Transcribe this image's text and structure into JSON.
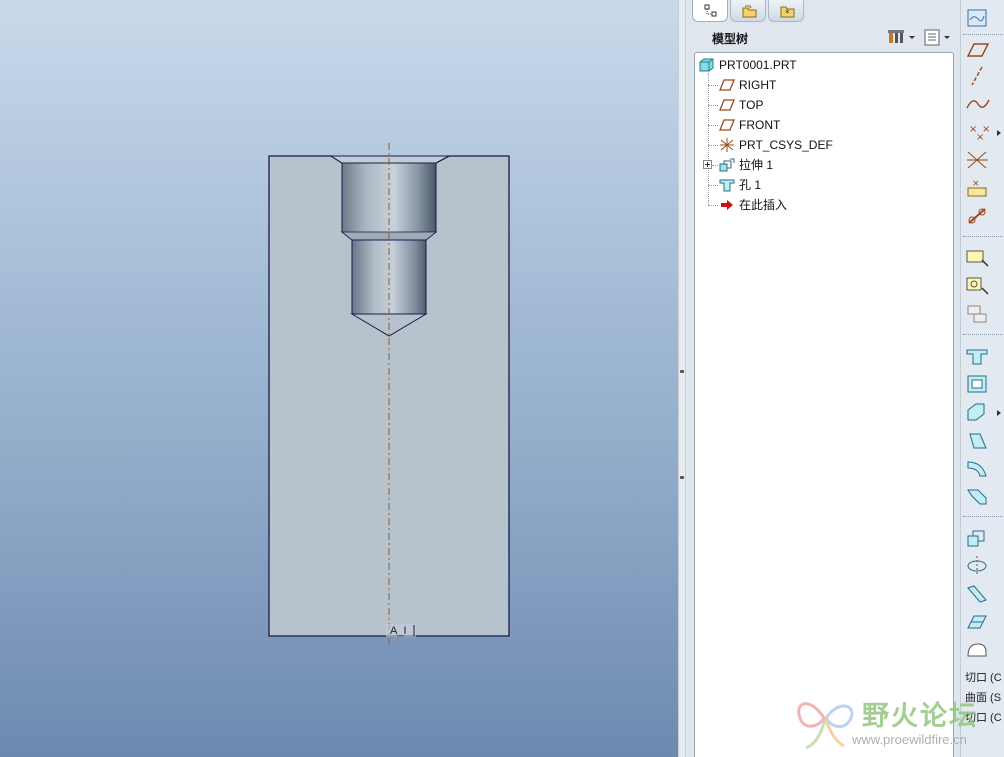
{
  "navigator": {
    "tabs": [
      {
        "icon": "model-tree-icon",
        "active": true
      },
      {
        "icon": "folder-browser-icon",
        "active": false
      },
      {
        "icon": "favorites-icon",
        "active": false
      }
    ],
    "tree_title": "模型树",
    "header_buttons": [
      "settings-icon",
      "show-icon"
    ]
  },
  "model_tree": {
    "items": [
      {
        "label": "PRT0001.PRT",
        "icon": "part-icon"
      },
      {
        "label": "RIGHT",
        "icon": "datum-plane-icon"
      },
      {
        "label": "TOP",
        "icon": "datum-plane-icon"
      },
      {
        "label": "FRONT",
        "icon": "datum-plane-icon"
      },
      {
        "label": "PRT_CSYS_DEF",
        "icon": "csys-icon"
      },
      {
        "label": "拉伸 1",
        "icon": "extrude-icon"
      },
      {
        "label": "孔 1",
        "icon": "hole-icon"
      },
      {
        "label": "在此插入",
        "icon": "insert-here-arrow-icon"
      }
    ]
  },
  "viewport": {
    "section_label": "A_I"
  },
  "toolbar": {
    "bottom_labels": [
      "切口 (C",
      "曲面 (S",
      "切口 (C"
    ]
  },
  "watermark": {
    "title": "野火论坛",
    "url": "www.proewildfire.cn"
  },
  "colors": {
    "background_top": "#c9d9ea",
    "background_bottom": "#6d89b0",
    "part_fill": "#b6c3cc",
    "edge": "#1a1a4a",
    "centerline": "#9a5a2a",
    "accent": "#3a8fd6"
  }
}
